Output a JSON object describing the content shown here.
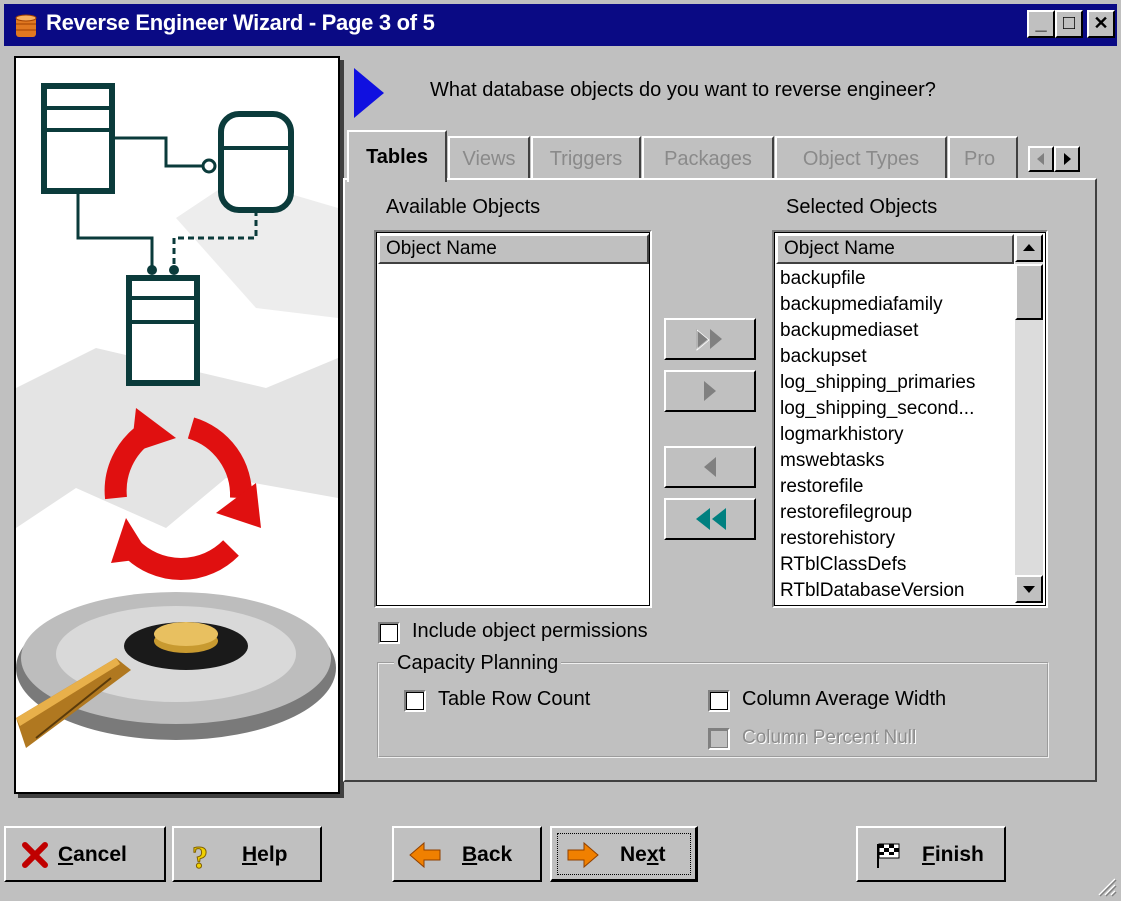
{
  "window": {
    "title": "Reverse Engineer Wizard - Page 3 of 5",
    "controls": {
      "minimize": "_",
      "maximize": "□",
      "close": "✕"
    }
  },
  "question": "What database objects do you want to reverse engineer?",
  "tabs": [
    {
      "label": "Tables",
      "active": true
    },
    {
      "label": "Views",
      "active": false
    },
    {
      "label": "Triggers",
      "active": false
    },
    {
      "label": "Packages",
      "active": false
    },
    {
      "label": "Object Types",
      "active": false
    },
    {
      "label": "Pro",
      "active": false
    }
  ],
  "available": {
    "heading": "Available Objects",
    "column": "Object Name",
    "items": []
  },
  "selected": {
    "heading": "Selected Objects",
    "column": "Object Name",
    "items": [
      "backupfile",
      "backupmediafamily",
      "backupmediaset",
      "backupset",
      "log_shipping_primaries",
      "log_shipping_second...",
      "logmarkhistory",
      "mswebtasks",
      "restorefile",
      "restorefilegroup",
      "restorehistory",
      "RTblClassDefs",
      "RTblDatabaseVersion"
    ]
  },
  "move_buttons": [
    {
      "name": "add-all-button",
      "icon": "double-right-arrow-icon",
      "enabled": false
    },
    {
      "name": "add-button",
      "icon": "right-arrow-icon",
      "enabled": false
    },
    {
      "name": "remove-button",
      "icon": "left-arrow-icon",
      "enabled": false
    },
    {
      "name": "remove-all-button",
      "icon": "double-left-arrow-icon",
      "enabled": true
    }
  ],
  "options": {
    "include_permissions": {
      "label": "Include object permissions",
      "checked": false
    }
  },
  "capacity": {
    "title": "Capacity Planning",
    "table_row_count": {
      "label": "Table Row Count",
      "checked": false
    },
    "column_avg_width": {
      "label": "Column Average Width",
      "checked": false
    },
    "column_pct_null": {
      "label": "Column Percent Null",
      "checked": false,
      "enabled": false
    }
  },
  "buttons": {
    "cancel": {
      "label": "Cancel",
      "mnemonic": "C",
      "rest": "ancel"
    },
    "help": {
      "label": "Help",
      "mnemonic": "H",
      "rest": "elp"
    },
    "back": {
      "label": "Back",
      "mnemonic": "B",
      "rest": "ack"
    },
    "next": {
      "label": "Next",
      "pre": "Ne",
      "mnemonic": "x",
      "rest": "t"
    },
    "finish": {
      "label": "Finish",
      "mnemonic": "F",
      "rest": "inish"
    }
  },
  "colors": {
    "titlebar": "#0a0a84",
    "face": "#c0c0c0",
    "arrow_marker": "#1010e0",
    "teal_arrow": "#008080",
    "cancel_x": "#c00000",
    "back_next_arrow": "#f08000"
  }
}
